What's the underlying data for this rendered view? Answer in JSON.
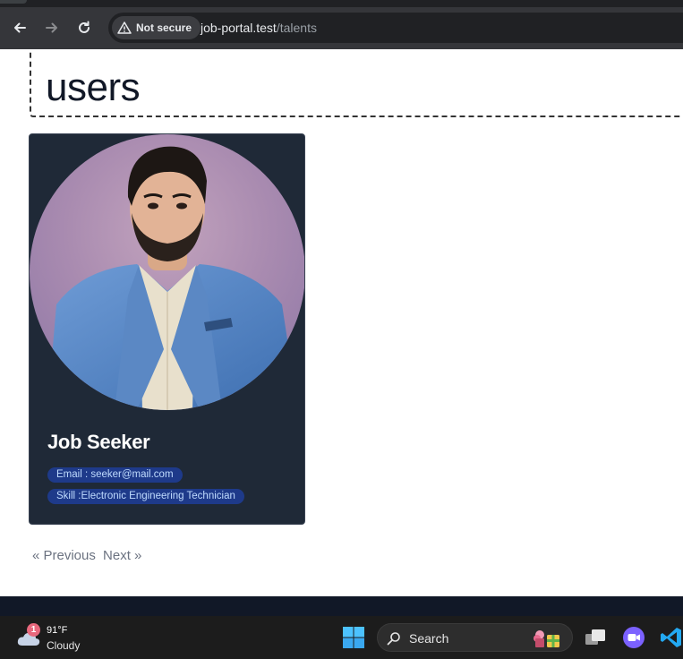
{
  "browser": {
    "security_label": "Not secure",
    "url_host": "job-portal.test",
    "url_path": "/talents"
  },
  "page": {
    "heading": "users"
  },
  "card": {
    "name": "Job Seeker",
    "email": "Email : seeker@mail.com",
    "skill": "Skill :Electronic Engineering Technician"
  },
  "pagination": {
    "previous": "« Previous",
    "next": "Next »"
  },
  "taskbar": {
    "weather_alert_count": "1",
    "temperature": "91°F",
    "condition": "Cloudy",
    "search_label": "Search"
  },
  "icons": {
    "back": "arrow-left-icon",
    "forward": "arrow-right-icon",
    "reload": "reload-icon",
    "warning": "warning-triangle-icon",
    "weather": "cloud-icon",
    "start": "windows-logo-icon",
    "search": "search-icon",
    "task_view": "task-view-icon",
    "chat": "chat-icon",
    "vscode": "vscode-icon"
  },
  "colors": {
    "card_bg": "#1f2937",
    "badge_bg": "#1e3a8a",
    "badge_text": "#bfdbfe"
  }
}
